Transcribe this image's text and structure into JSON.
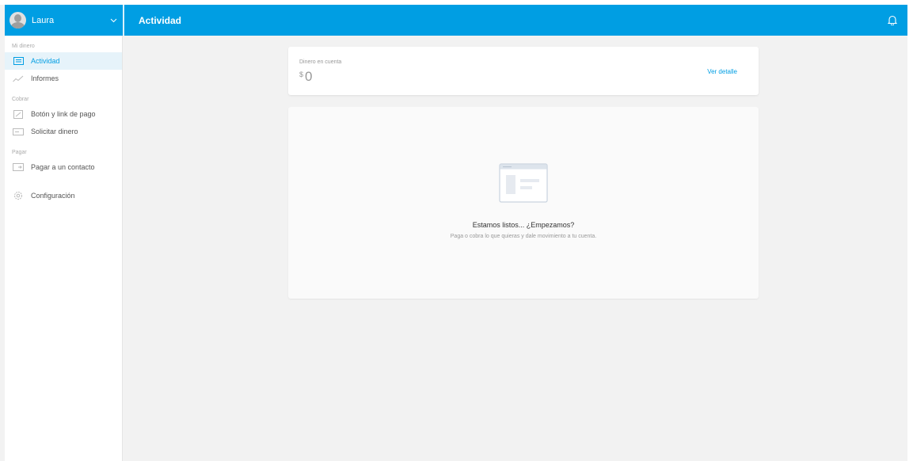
{
  "header": {
    "user_name": "Laura",
    "page_title": "Actividad",
    "bell_icon": "bell-icon",
    "accent_color": "#009ee3"
  },
  "sidebar": {
    "sections": [
      {
        "label": "Mi dinero",
        "items": [
          {
            "label": "Actividad",
            "icon": "activity-icon",
            "active": true
          },
          {
            "label": "Informes",
            "icon": "chart-icon",
            "active": false
          }
        ]
      },
      {
        "label": "Cobrar",
        "items": [
          {
            "label": "Botón y link de pago",
            "icon": "link-icon",
            "active": false
          },
          {
            "label": "Solicitar dinero",
            "icon": "request-money-icon",
            "active": false
          }
        ]
      },
      {
        "label": "Pagar",
        "items": [
          {
            "label": "Pagar a un contacto",
            "icon": "pay-contact-icon",
            "active": false
          }
        ]
      }
    ],
    "settings": {
      "label": "Configuración",
      "icon": "gear-icon"
    }
  },
  "balance": {
    "label": "Dinero en cuenta",
    "currency": "$",
    "amount": "0",
    "detail_link": "Ver detalle"
  },
  "empty_state": {
    "title": "Estamos listos... ¿Empezamos?",
    "description": "Paga o cobra lo que quieras y dale movimiento a tu cuenta."
  }
}
